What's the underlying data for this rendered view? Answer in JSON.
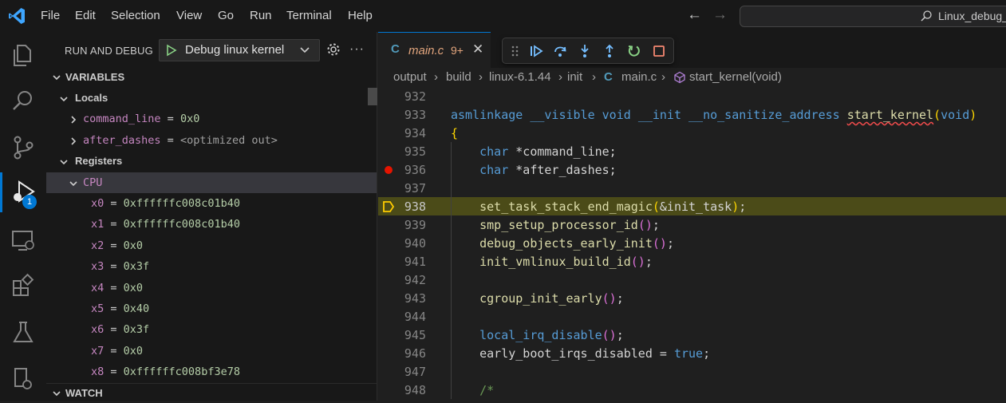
{
  "menu": [
    "File",
    "Edit",
    "Selection",
    "View",
    "Go",
    "Run",
    "Terminal",
    "Help"
  ],
  "search": {
    "text": "Linux_debug_"
  },
  "activity": {
    "badge": "1"
  },
  "sidebar": {
    "title": "RUN AND DEBUG",
    "config": "Debug linux kernel",
    "variables_header": "VARIABLES",
    "locals_label": "Locals",
    "locals": [
      {
        "name": "command_line",
        "value": "0x0"
      },
      {
        "name": "after_dashes",
        "value": "<optimized out>"
      }
    ],
    "registers_label": "Registers",
    "cpu_label": "CPU",
    "registers": [
      {
        "name": "x0",
        "value": "0xffffffc008c01b40"
      },
      {
        "name": "x1",
        "value": "0xffffffc008c01b40"
      },
      {
        "name": "x2",
        "value": "0x0"
      },
      {
        "name": "x3",
        "value": "0x3f"
      },
      {
        "name": "x4",
        "value": "0x0"
      },
      {
        "name": "x5",
        "value": "0x40"
      },
      {
        "name": "x6",
        "value": "0x3f"
      },
      {
        "name": "x7",
        "value": "0x0"
      },
      {
        "name": "x8",
        "value": "0xffffffc008bf3e78"
      }
    ],
    "watch_header": "WATCH"
  },
  "editor": {
    "tab": {
      "icon": "C",
      "name": "main.c",
      "count": "9+"
    },
    "breadcrumb": [
      "output",
      "build",
      "linux-6.1.44",
      "init",
      "main.c",
      "start_kernel(void)"
    ],
    "breadcrumb_c_icon": "C",
    "lines": [
      "932",
      "933",
      "934",
      "935",
      "936",
      "937",
      "938",
      "939",
      "940",
      "941",
      "942",
      "943",
      "944",
      "945",
      "946",
      "947",
      "948"
    ]
  },
  "colors": {
    "accent": "#0078d4",
    "current_line": "#4b4b18",
    "breakpoint": "#e51400"
  }
}
